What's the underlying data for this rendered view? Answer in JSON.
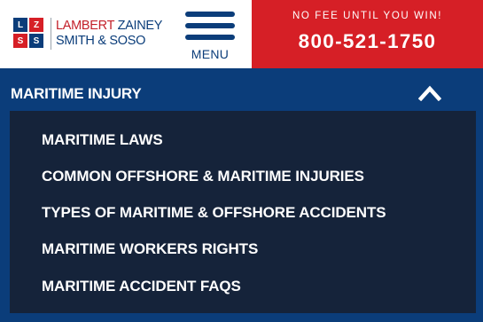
{
  "header": {
    "logo": {
      "letters": [
        "L",
        "Z",
        "S",
        "S"
      ],
      "line1_first": "LAMBERT",
      "line1_rest": " ZAINEY",
      "line2": "SMITH & SOSO"
    },
    "menu_label": "MENU",
    "cta": {
      "tagline": "NO FEE UNTIL YOU WIN!",
      "phone": "800-521-1750"
    }
  },
  "section": {
    "title": "MARITIME INJURY",
    "expanded_icon": "chevron-up-icon"
  },
  "submenu": {
    "items": [
      "MARITIME LAWS",
      "COMMON OFFSHORE & MARITIME INJURIES",
      "TYPES OF MARITIME & OFFSHORE ACCIDENTS",
      "MARITIME WORKERS RIGHTS",
      "MARITIME ACCIDENT FAQS"
    ]
  },
  "colors": {
    "navy": "#0b3d7a",
    "red": "#d61f26",
    "submenu_bg": "#15233a",
    "white": "#ffffff"
  }
}
